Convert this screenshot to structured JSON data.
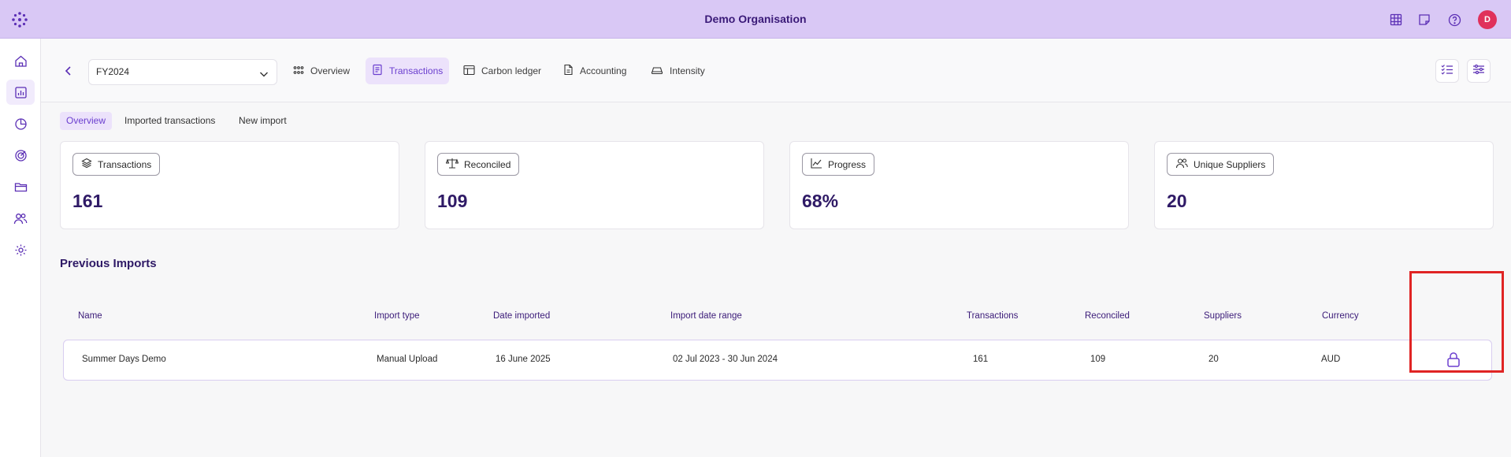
{
  "header": {
    "org_name": "Demo Organisation",
    "avatar_initial": "D",
    "brand_color": "#d9c8f5",
    "accent_color": "#6b3fcf"
  },
  "header_icons": [
    "table-icon",
    "note-icon",
    "help-icon"
  ],
  "sidebar": {
    "items": [
      "home-icon",
      "chart-icon",
      "pie-chart-icon",
      "target-icon",
      "folder-icon",
      "users-icon",
      "gear-icon"
    ],
    "active": "chart-icon"
  },
  "toolbar": {
    "year_select": "FY2024",
    "tabs": [
      {
        "label": "Overview",
        "icon": "grid-dots-icon"
      },
      {
        "label": "Transactions",
        "icon": "receipt-icon",
        "active": true
      },
      {
        "label": "Carbon ledger",
        "icon": "table-icon"
      },
      {
        "label": "Accounting",
        "icon": "document-icon"
      },
      {
        "label": "Intensity",
        "icon": "car-icon"
      }
    ]
  },
  "subtabs": [
    "Overview",
    "Imported transactions",
    "New import"
  ],
  "stats": [
    {
      "label": "Transactions",
      "value": "161",
      "icon": "layers-icon"
    },
    {
      "label": "Reconciled",
      "value": "109",
      "icon": "scale-icon"
    },
    {
      "label": "Progress",
      "value": "68%",
      "icon": "trend-icon"
    },
    {
      "label": "Unique Suppliers",
      "value": "20",
      "icon": "users-icon"
    }
  ],
  "imports": {
    "title": "Previous Imports",
    "columns": [
      "Name",
      "Import type",
      "Date imported",
      "Import date range",
      "Transactions",
      "Reconciled",
      "Suppliers",
      "Currency"
    ],
    "rows": [
      {
        "name": "Summer Days Demo",
        "type": "Manual Upload",
        "date": "16 June 2025",
        "range": "02 Jul 2023 - 30 Jun 2024",
        "transactions": "161",
        "reconciled": "109",
        "suppliers": "20",
        "currency": "AUD",
        "action_icon": "lock-icon"
      }
    ]
  }
}
